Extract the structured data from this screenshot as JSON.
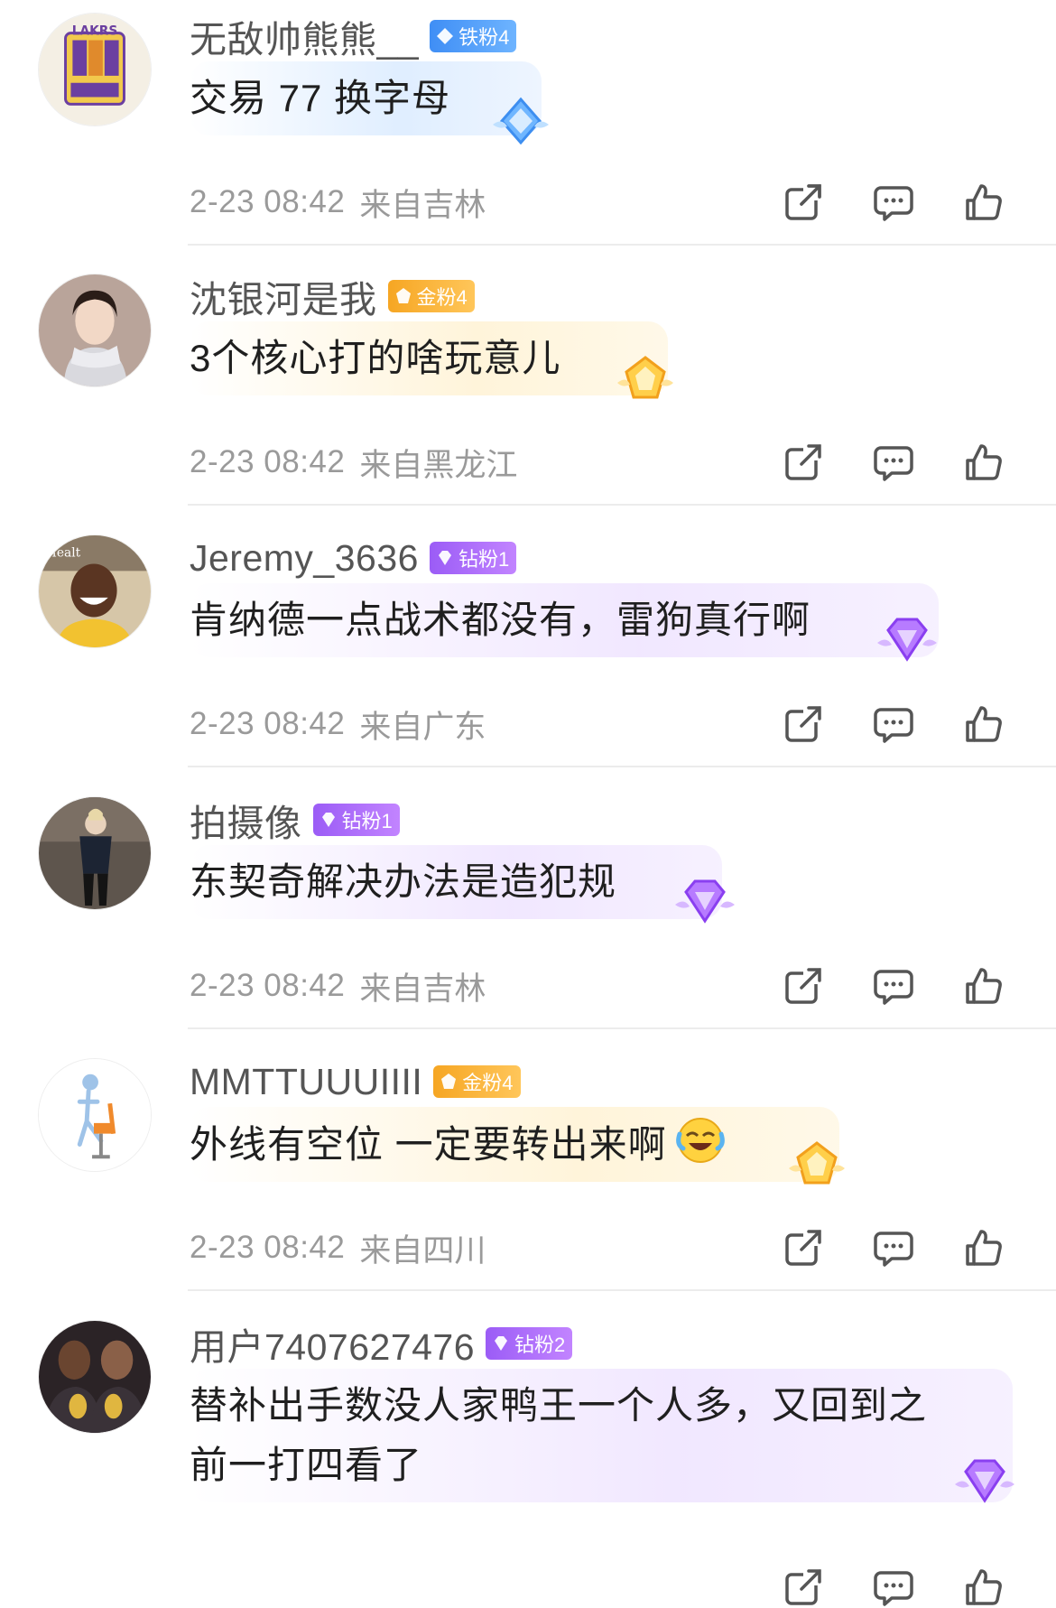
{
  "comments": [
    {
      "username": "无敌帅熊熊__",
      "badge": "铁粉4",
      "badge_type": "iron",
      "text": "交易 77 换字母",
      "time": "2-23 08:42",
      "location": "来自吉林",
      "avatar": "lakers-cartoon-avatar"
    },
    {
      "username": "沈银河是我",
      "badge": "金粉4",
      "badge_type": "gold",
      "text": "3个核心打的啥玩意儿",
      "time": "2-23 08:42",
      "location": "来自黑龙江",
      "avatar": "woman-scarf-avatar"
    },
    {
      "username": "Jeremy_3636",
      "badge": "钻粉1",
      "badge_type": "diamond",
      "text": "肯纳德一点战术都没有，雷狗真行啊",
      "time": "2-23 08:42",
      "location": "来自广东",
      "avatar": "smiling-man-avatar"
    },
    {
      "username": "拍摄像",
      "badge": "钻粉1",
      "badge_type": "diamond",
      "text": "东契奇解决办法是造犯规",
      "time": "2-23 08:42",
      "location": "来自吉林",
      "avatar": "walking-person-avatar"
    },
    {
      "username": "MMTTUUUIIII",
      "badge": "金粉4",
      "badge_type": "gold",
      "text": "外线有空位 一定要转出来啊",
      "emoji": "laugh-cry-emoji",
      "time": "2-23 08:42",
      "location": "来自四川",
      "avatar": "skeleton-chair-avatar"
    },
    {
      "username": "用户7407627476",
      "badge": "钻粉2",
      "badge_type": "diamond",
      "text_line1": "替补出手数没人家鸭王一个人多，又回到之",
      "text_line2": "前一打四看了",
      "time": "",
      "location": "",
      "avatar": "two-players-trophy-avatar"
    }
  ],
  "actions": {
    "share_icon": "share-icon",
    "comment_icon": "comment-icon",
    "like_icon": "thumbs-up-icon"
  },
  "colors": {
    "iron": "#4a97f7",
    "gold": "#f7ac2c",
    "diamond": "#a466f7",
    "meta": "#9a9a9a"
  }
}
